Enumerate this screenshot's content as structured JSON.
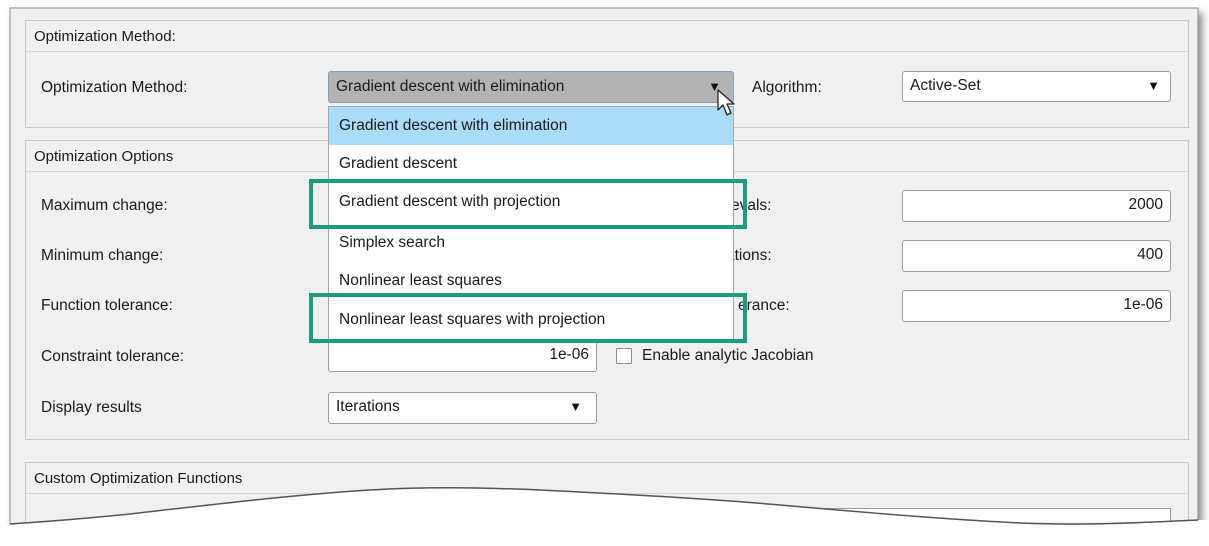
{
  "optimization_method_panel": {
    "title": "Optimization Method:",
    "method_label": "Optimization Method:",
    "method_value": "Gradient descent with elimination",
    "algorithm_label": "Algorithm:",
    "algorithm_value": "Active-Set"
  },
  "method_dropdown": {
    "options": [
      "Gradient descent with elimination",
      "Gradient descent",
      "Gradient descent with projection",
      "Simplex search",
      "Nonlinear least squares",
      "Nonlinear least squares with projection"
    ],
    "selected_index": 0,
    "highlighted_indices": [
      2,
      5
    ]
  },
  "optimization_options_panel": {
    "title": "Optimization Options",
    "max_change_label": "Maximum change:",
    "min_change_label": "Minimum change:",
    "func_tol_label": "Function tolerance:",
    "constraint_tol_label": "Constraint tolerance:",
    "constraint_tol_value": "1e-06",
    "enable_jacobian_label": "Enable analytic Jacobian",
    "display_results_label": "Display results",
    "display_results_value": "Iterations",
    "right_label_1_visible": "evals:",
    "right_value_1": "2000",
    "right_label_2_visible": "ations:",
    "right_value_2": "400",
    "right_label_3_visible": "erance:",
    "right_value_3": "1e-06"
  },
  "custom_functions_panel": {
    "title": "Custom Optimization Functions"
  },
  "colors": {
    "highlight_box": "#1a9e7f",
    "selected_option_bg": "#aadcf8",
    "dropdown_open_bg": "#b3b3b3",
    "panel_bg": "#f0f0f0"
  }
}
